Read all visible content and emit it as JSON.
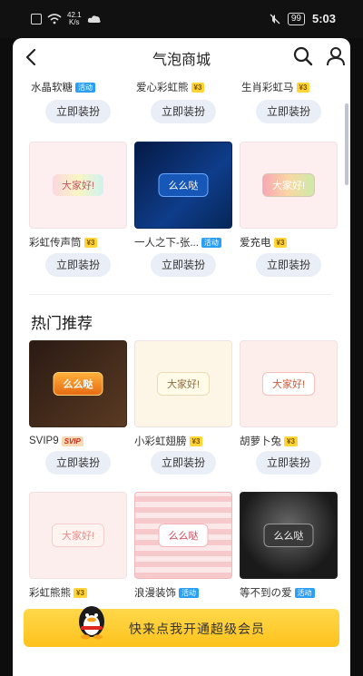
{
  "status": {
    "speed_value": "42.1",
    "speed_unit": "K/s",
    "battery": "99",
    "time": "5:03"
  },
  "header": {
    "title": "气泡商城"
  },
  "row1": [
    {
      "name": "水晶软糖",
      "tag": "活动"
    },
    {
      "name": "爱心彩虹熊",
      "tag": "¥3"
    },
    {
      "name": "生肖彩虹马",
      "tag": "¥3"
    }
  ],
  "row2": [
    {
      "name": "彩虹传声筒",
      "tag": "¥3",
      "bubble": "大家好!"
    },
    {
      "name": "一人之下-张...",
      "tag": "活动",
      "bubble": "么么哒"
    },
    {
      "name": "爱充电",
      "tag": "¥3",
      "bubble": "大家好!"
    }
  ],
  "section": {
    "title": "热门推荐"
  },
  "row3": [
    {
      "name": "SVIP9",
      "tag": "SVIP",
      "bubble": "么么哒"
    },
    {
      "name": "小彩虹翅膀",
      "tag": "¥3",
      "bubble": "大家好!"
    },
    {
      "name": "胡萝卜兔",
      "tag": "¥3",
      "bubble": "大家好!"
    }
  ],
  "row4": [
    {
      "name": "彩虹熊熊",
      "tag": "¥3",
      "bubble": "大家好!"
    },
    {
      "name": "浪漫装饰",
      "tag": "活动",
      "bubble": "么么哒"
    },
    {
      "name": "等不到の爱",
      "tag": "活动",
      "bubble": "么么哒"
    }
  ],
  "button_label": "立即装扮",
  "promo": {
    "text": "快来点我开通超级会员"
  }
}
